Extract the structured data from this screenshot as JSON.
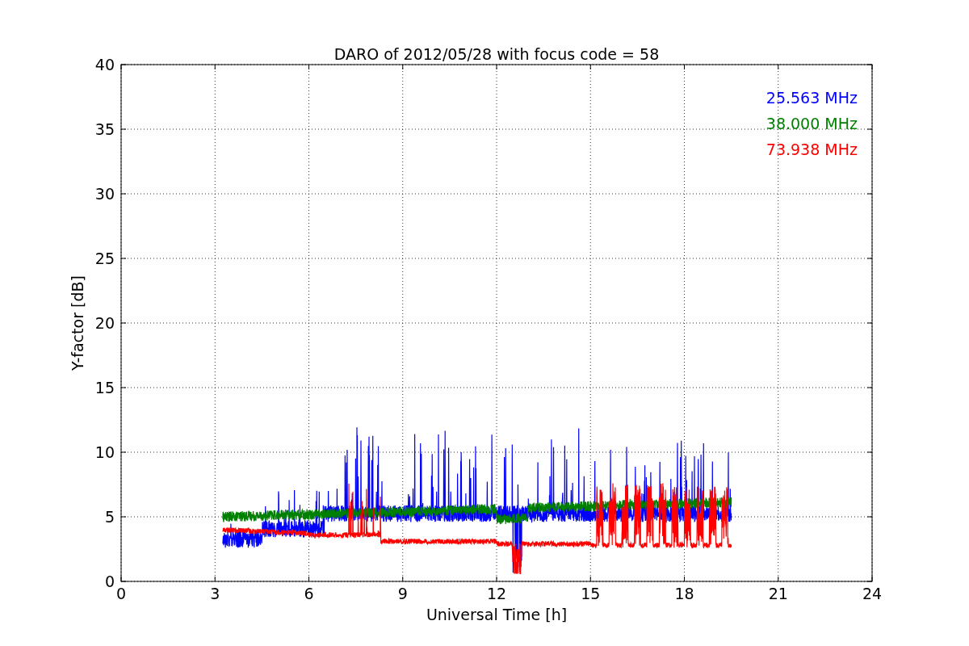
{
  "chart_data": {
    "type": "line",
    "title": "DARO of 2012/05/28 with focus code = 58",
    "xlabel": "Universal Time [h]",
    "ylabel": "Y-factor [dB]",
    "xlim": [
      0,
      24
    ],
    "ylim": [
      0,
      40
    ],
    "grid": true,
    "xticks": [
      0,
      3,
      6,
      9,
      12,
      15,
      18,
      21,
      24
    ],
    "yticks": [
      0,
      5,
      10,
      15,
      20,
      25,
      30,
      35,
      40
    ]
  },
  "legend": [
    {
      "label": "25.563 MHz",
      "color": "#0000ff"
    },
    {
      "label": "38.000 MHz",
      "color": "#008000"
    },
    {
      "label": "73.938 MHz",
      "color": "#ff0000"
    }
  ]
}
